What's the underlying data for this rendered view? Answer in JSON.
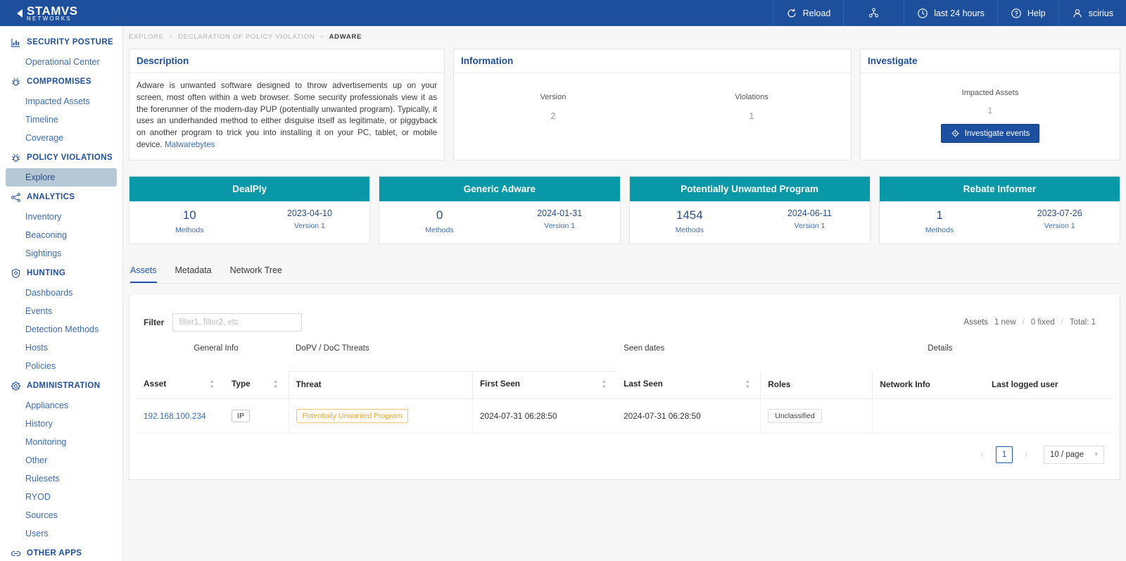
{
  "topbar": {
    "logo_main": "STAMVS",
    "logo_sub": "NETWORKS",
    "reload_label": "Reload",
    "share_icon": "network-share-icon",
    "time_range_label": "last 24 hours",
    "help_label": "Help",
    "user_label": "scirius"
  },
  "sidebar": {
    "sections": [
      {
        "title": "SECURITY POSTURE",
        "icon": "bar-chart-icon",
        "items": [
          {
            "label": "Operational Center",
            "active": false
          }
        ]
      },
      {
        "title": "COMPROMISES",
        "icon": "bug-icon",
        "items": [
          {
            "label": "Impacted Assets",
            "active": false
          },
          {
            "label": "Timeline",
            "active": false
          },
          {
            "label": "Coverage",
            "active": false
          }
        ]
      },
      {
        "title": "POLICY VIOLATIONS",
        "icon": "bug-icon",
        "items": [
          {
            "label": "Explore",
            "active": true
          }
        ]
      },
      {
        "title": "ANALYTICS",
        "icon": "share-nodes-icon",
        "items": [
          {
            "label": "Inventory",
            "active": false
          },
          {
            "label": "Beaconing",
            "active": false
          },
          {
            "label": "Sightings",
            "active": false
          }
        ]
      },
      {
        "title": "HUNTING",
        "icon": "shield-icon",
        "items": [
          {
            "label": "Dashboards",
            "active": false
          },
          {
            "label": "Events",
            "active": false
          },
          {
            "label": "Detection Methods",
            "active": false
          },
          {
            "label": "Hosts",
            "active": false
          },
          {
            "label": "Policies",
            "active": false
          }
        ]
      },
      {
        "title": "ADMINISTRATION",
        "icon": "gear-icon",
        "items": [
          {
            "label": "Appliances",
            "active": false
          },
          {
            "label": "History",
            "active": false
          },
          {
            "label": "Monitoring",
            "active": false
          },
          {
            "label": "Other",
            "active": false
          },
          {
            "label": "Rulesets",
            "active": false
          },
          {
            "label": "RYOD",
            "active": false
          },
          {
            "label": "Sources",
            "active": false
          },
          {
            "label": "Users",
            "active": false
          }
        ]
      },
      {
        "title": "OTHER APPS",
        "icon": "link-icon",
        "items": []
      }
    ]
  },
  "breadcrumb": {
    "items": [
      "EXPLORE",
      "DECLARATION OF POLICY VIOLATION",
      "ADWARE"
    ],
    "separator": ">"
  },
  "description": {
    "title": "Description",
    "text": "Adware is unwanted software designed to throw advertisements up on your screen, most often within a web browser. Some security professionals view it as the forerunner of the modern-day PUP (potentially unwanted program). Typically, it uses an underhanded method to either disguise itself as legitimate, or piggyback on another program to trick you into installing it on your PC, tablet, or mobile device. ",
    "link_label": "Malwarebytes"
  },
  "information": {
    "title": "Information",
    "stats": [
      {
        "label": "Version",
        "value": "2"
      },
      {
        "label": "Violations",
        "value": "1"
      }
    ]
  },
  "investigate": {
    "title": "Investigate",
    "metric_label": "Impacted Assets",
    "metric_value": "1",
    "button_label": "Investigate events",
    "button_icon": "crosshair-icon",
    "accent_color": "#1d4fa0"
  },
  "threat_cards": {
    "accent_color": "#0898a7",
    "items": [
      {
        "title": "DealPly",
        "count": "10",
        "count_label": "Methods",
        "date": "2023-04-10",
        "version_label": "Version 1"
      },
      {
        "title": "Generic Adware",
        "count": "0",
        "count_label": "Methods",
        "date": "2024-01-31",
        "version_label": "Version 1"
      },
      {
        "title": "Potentially Unwanted Program",
        "count": "1454",
        "count_label": "Methods",
        "date": "2024-06-11",
        "version_label": "Version 1"
      },
      {
        "title": "Rebate Informer",
        "count": "1",
        "count_label": "Methods",
        "date": "2023-07-26",
        "version_label": "Version 1"
      }
    ]
  },
  "tabs": [
    {
      "label": "Assets",
      "active": true
    },
    {
      "label": "Metadata",
      "active": false
    },
    {
      "label": "Network Tree",
      "active": false
    }
  ],
  "filter": {
    "label": "Filter",
    "placeholder": "filter1, filter2, etc",
    "value": ""
  },
  "summary": {
    "title": "Assets",
    "new": "1 new",
    "fixed": "0 fixed",
    "total": "Total: 1",
    "separator": "/"
  },
  "table": {
    "groups": [
      {
        "label": "General Info"
      },
      {
        "label": "DoPV / DoC Threats"
      },
      {
        "label": "Seen dates"
      },
      {
        "label": "Details"
      }
    ],
    "columns": [
      {
        "label": "Asset",
        "sortable": true
      },
      {
        "label": "Type",
        "sortable": true
      },
      {
        "label": "Threat",
        "sortable": false
      },
      {
        "label": "First Seen",
        "sortable": true
      },
      {
        "label": "Last Seen",
        "sortable": true
      },
      {
        "label": "Roles",
        "sortable": false
      },
      {
        "label": "Network Info",
        "sortable": false
      },
      {
        "label": "Last logged user",
        "sortable": false
      }
    ],
    "rows": [
      {
        "asset": "192.168.100.234",
        "type": "IP",
        "threat": "Potentially Unwanted Program",
        "first_seen": "2024-07-31 06:28:50",
        "last_seen": "2024-07-31 06:28:50",
        "roles": "Unclassified",
        "network_info": "",
        "last_logged_user": ""
      }
    ]
  },
  "pagination": {
    "prev_icon": "chevron-left-icon",
    "next_icon": "chevron-right-icon",
    "current_page": "1",
    "page_size_label": "10 / page",
    "caret_icon": "chevron-down-icon"
  }
}
